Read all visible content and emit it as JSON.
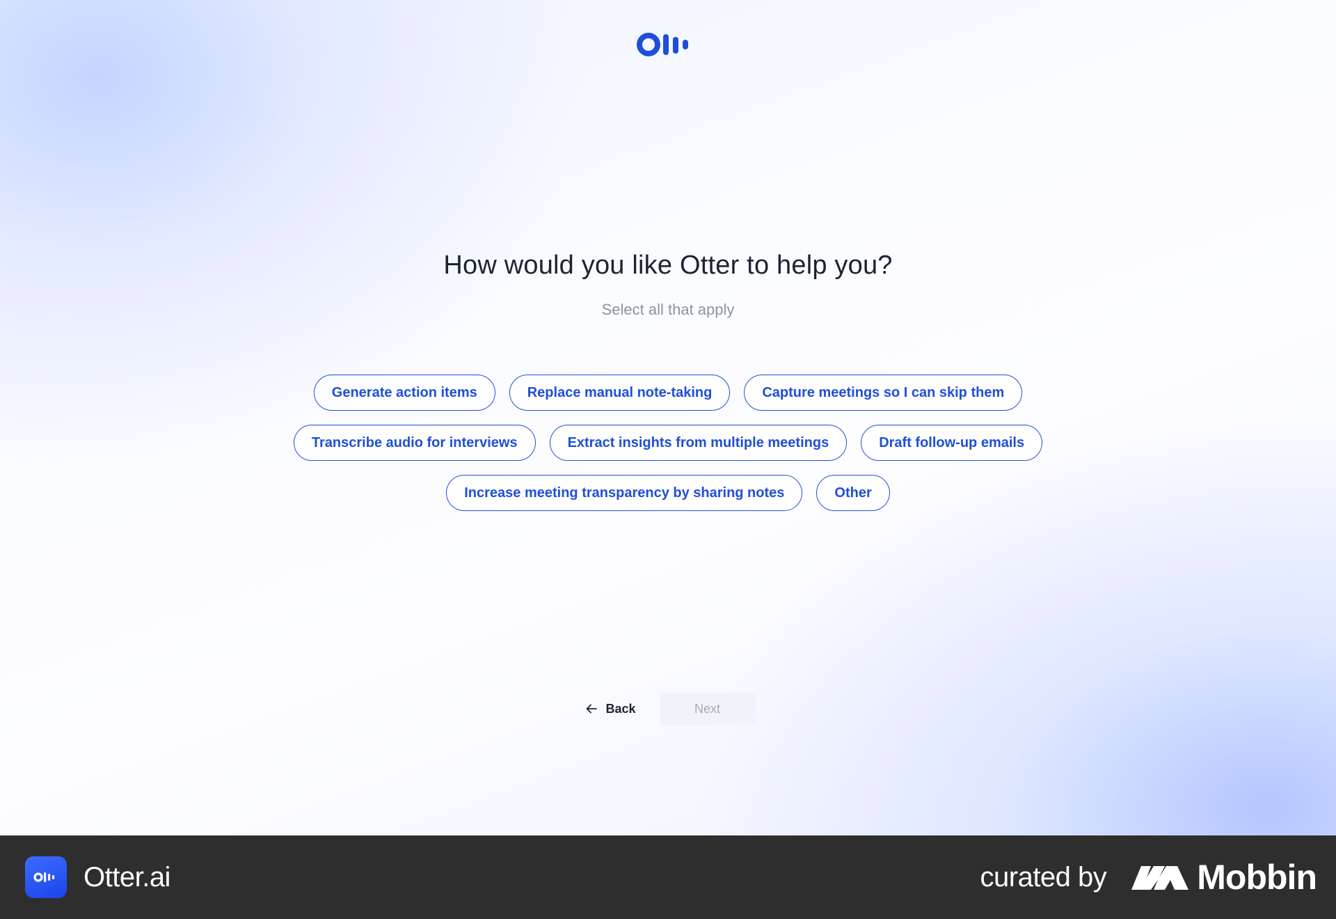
{
  "brand": {
    "logo_icon": "otter-logo-icon",
    "accent": "#1f4fd6"
  },
  "question": {
    "title": "How would you like Otter to help you?",
    "subtitle": "Select all that apply"
  },
  "options": [
    [
      "Generate action items",
      "Replace manual note-taking",
      "Capture meetings so I can skip them"
    ],
    [
      "Transcribe audio for interviews",
      "Extract insights from multiple meetings",
      "Draft follow-up emails"
    ],
    [
      "Increase meeting transparency by sharing notes",
      "Other"
    ]
  ],
  "nav": {
    "back_label": "Back",
    "back_icon": "arrow-left-icon",
    "next_label": "Next"
  },
  "footer": {
    "app_name": "Otter.ai",
    "curated_label": "curated by",
    "curator_name": "Mobbin",
    "background": "#2e2e2e"
  }
}
